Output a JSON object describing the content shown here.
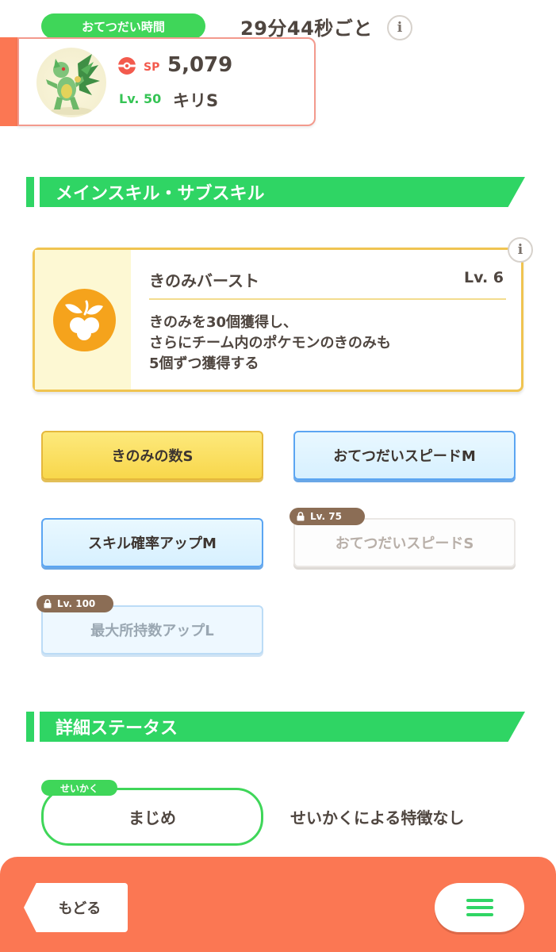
{
  "help": {
    "label": "おてつだい時間",
    "time": "29分44秒ごと",
    "info_icon": "info-icon"
  },
  "pokemon": {
    "sp_label": "SP",
    "sp_value": "5,079",
    "level": "Lv. 50",
    "name": "キリS",
    "sprite": "pokemon-sprite"
  },
  "sections": {
    "skills_title": "メインスキル・サブスキル",
    "status_title": "詳細ステータス"
  },
  "main_skill": {
    "name": "きのみバースト",
    "level": "Lv. 6",
    "desc": [
      "きのみを30個獲得し、",
      "さらにチーム内のポケモンのきのみも",
      "5個ずつ獲得する"
    ],
    "icon": "berry-icon"
  },
  "sub_skills": [
    {
      "label": "きのみの数S"
    },
    {
      "label": "おてつだいスピードM"
    },
    {
      "label": "スキル確率アップM"
    },
    {
      "label": "おてつだいスピードS",
      "lock": "Lv. 75"
    },
    {
      "label": "最大所持数アップL",
      "lock": "Lv. 100"
    }
  ],
  "nature": {
    "tag": "せいかく",
    "value": "まじめ",
    "effect": "せいかくによる特徴なし"
  },
  "nav": {
    "back": "もどる",
    "menu_icon": "hamburger-menu-icon"
  },
  "colors": {
    "green": "#2fd564",
    "orange": "#fb7753",
    "gold": "#f8d74b",
    "blue_border": "#5ba5f2"
  }
}
